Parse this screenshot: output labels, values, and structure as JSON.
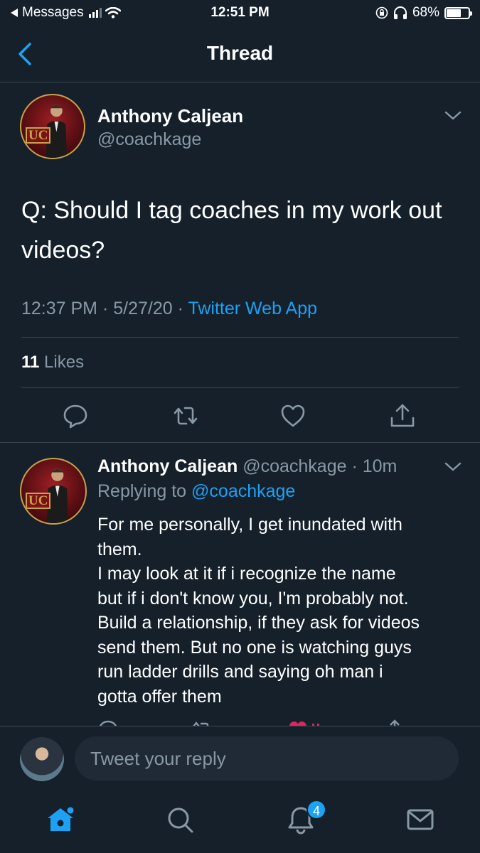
{
  "status_bar": {
    "back_app": "Messages",
    "time": "12:51 PM",
    "battery": "68%",
    "battery_level": 0.68
  },
  "nav": {
    "title": "Thread"
  },
  "main_tweet": {
    "author_name": "Anthony Caljean",
    "author_handle": "@coachkage",
    "avatar_text": "UC",
    "text": "Q: Should I tag coaches in my work out videos?",
    "time": "12:37 PM",
    "date": "5/27/20",
    "source": "Twitter Web App",
    "likes_count": "11",
    "likes_label": "Likes"
  },
  "reply_tweet": {
    "author_name": "Anthony Caljean",
    "author_handle": "@coachkage",
    "age": "10m",
    "avatar_text": "UC",
    "replying_prefix": "Replying to",
    "replying_handle": "@coachkage",
    "lines": [
      "For me personally, I get inundated with",
      "them.",
      "I may look at it if i recognize the name",
      "but if i don't know you, I'm probably not.",
      "Build a relationship, if they ask for videos",
      "send them. But no one is watching guys",
      "run ladder drills and saying oh man i",
      "gotta offer them"
    ]
  },
  "compose": {
    "placeholder": "Tweet your reply"
  },
  "tabbar": {
    "notifications_badge": "4"
  },
  "colors": {
    "background": "#15202b",
    "accent": "#1da1f2",
    "muted": "#8899a6",
    "divider": "#38444d",
    "like": "#e0245e"
  }
}
